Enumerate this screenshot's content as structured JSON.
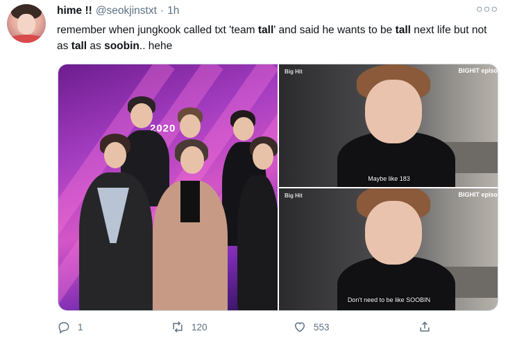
{
  "tweet": {
    "display_name": "hime !!",
    "handle": "@seokjinstxt",
    "separator": "·",
    "time": "1h",
    "text_parts": [
      "remember when jungkook called txt 'team ",
      "tall",
      "' and said he wants to be ",
      "tall",
      " next life but not as ",
      "tall",
      " as ",
      "soobin",
      ".. hehe"
    ],
    "more_icon": "more-horizontal-icon"
  },
  "media": {
    "left_photo": {
      "logo_text": "2020"
    },
    "top_right": {
      "watermark_left": "Big Hit",
      "watermark_right": "BIGHIT episo",
      "caption": "Maybe like 183"
    },
    "bottom_right": {
      "watermark_left": "Big Hit",
      "watermark_right": "BIGHIT episo",
      "caption": "Don't need to be like SOOBIN"
    }
  },
  "actions": {
    "reply_count": "1",
    "retweet_count": "120",
    "like_count": "553",
    "icons": [
      "reply-icon",
      "retweet-icon",
      "like-icon",
      "share-icon"
    ]
  },
  "colors": {
    "text": "#0f1419",
    "secondary": "#5b7083",
    "border": "#cfd9de"
  }
}
